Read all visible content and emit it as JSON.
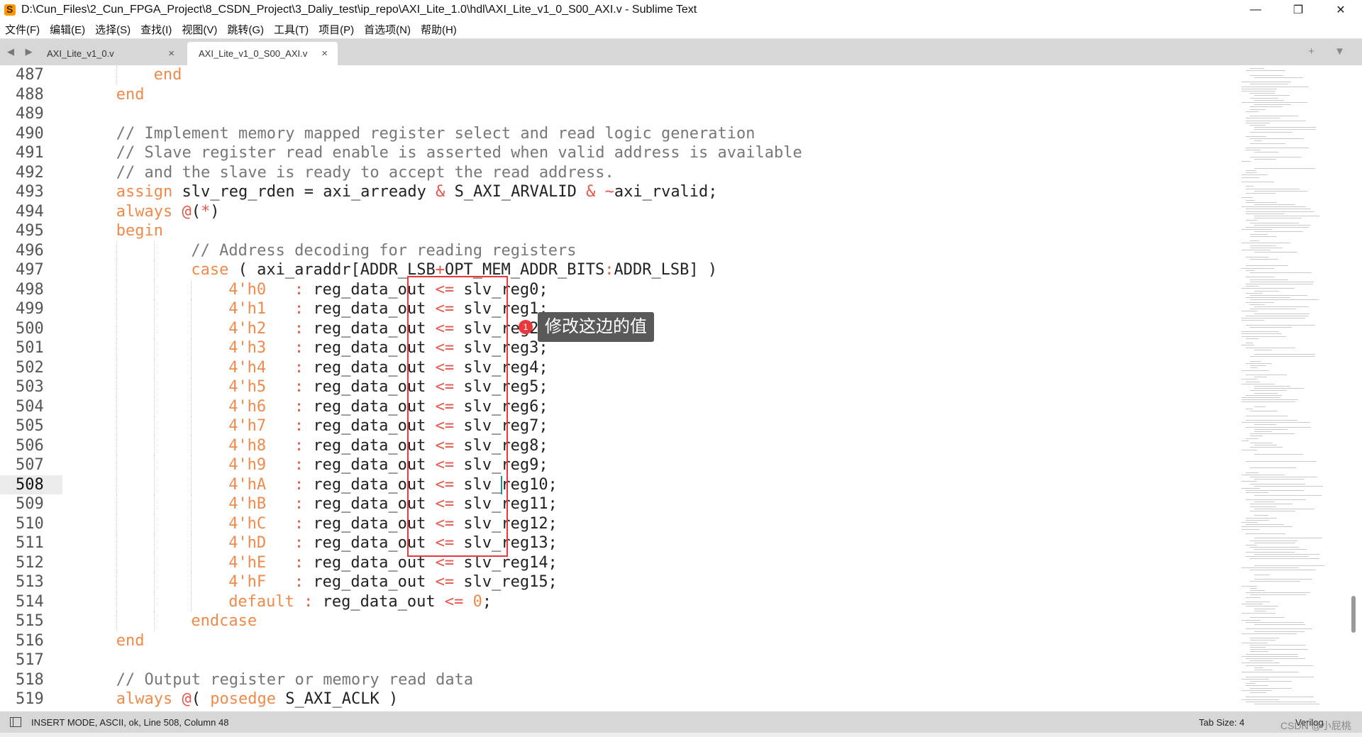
{
  "window": {
    "title": "D:\\Cun_Files\\2_Cun_FPGA_Project\\8_CSDN_Project\\3_Daliy_test\\ip_repo\\AXI_Lite_1.0\\hdl\\AXI_Lite_v1_0_S00_AXI.v - Sublime Text",
    "controls": [
      "—",
      "❐",
      "✕"
    ]
  },
  "menu": [
    "文件(F)",
    "编辑(E)",
    "选择(S)",
    "查找(I)",
    "视图(V)",
    "跳转(G)",
    "工具(T)",
    "项目(P)",
    "首选项(N)",
    "帮助(H)"
  ],
  "tabs": [
    {
      "label": "AXI_Lite_v1_0.v",
      "close": "×",
      "active": false
    },
    {
      "label": "AXI_Lite_v1_0_S00_AXI.v",
      "close": "×",
      "active": true
    }
  ],
  "tab_nav": "◀ ▶",
  "tab_right": "+ ▼",
  "editor": {
    "current_line": 508,
    "lines": [
      {
        "n": "487",
        "indent": 4,
        "tokens": [
          [
            "kw",
            "end"
          ]
        ]
      },
      {
        "n": "488",
        "indent": 2,
        "tokens": [
          [
            "kw",
            "end"
          ]
        ]
      },
      {
        "n": "489",
        "indent": 0,
        "tokens": []
      },
      {
        "n": "490",
        "indent": 2,
        "tokens": [
          [
            "cm",
            "// Implement memory mapped register select and read logic generation"
          ]
        ]
      },
      {
        "n": "491",
        "indent": 2,
        "tokens": [
          [
            "cm",
            "// Slave register read enable is asserted when valid address is available"
          ]
        ]
      },
      {
        "n": "492",
        "indent": 2,
        "tokens": [
          [
            "cm",
            "// and the slave is ready to accept the read address."
          ]
        ]
      },
      {
        "n": "493",
        "indent": 2,
        "tokens": [
          [
            "kw",
            "assign"
          ],
          [
            "tx",
            " slv_reg_rden = axi_arready "
          ],
          [
            "op",
            "&"
          ],
          [
            "tx",
            " S_AXI_ARVALID "
          ],
          [
            "op",
            "&"
          ],
          [
            "tx",
            " "
          ],
          [
            "op",
            "~"
          ],
          [
            "tx",
            "axi_rvalid;"
          ]
        ]
      },
      {
        "n": "494",
        "indent": 2,
        "tokens": [
          [
            "kw",
            "always"
          ],
          [
            "tx",
            " "
          ],
          [
            "op",
            "@"
          ],
          [
            "tx",
            "("
          ],
          [
            "op",
            "*"
          ],
          [
            "tx",
            ")"
          ]
        ]
      },
      {
        "n": "495",
        "indent": 2,
        "tokens": [
          [
            "kw",
            "begin"
          ]
        ]
      },
      {
        "n": "496",
        "indent": 6,
        "tokens": [
          [
            "cm",
            "// Address decoding for reading registers"
          ]
        ]
      },
      {
        "n": "497",
        "indent": 6,
        "tokens": [
          [
            "kw",
            "case"
          ],
          [
            "tx",
            " ( axi_araddr[ADDR_LSB"
          ],
          [
            "op",
            "+"
          ],
          [
            "tx",
            "OPT_MEM_ADDR_BITS"
          ],
          [
            "op",
            ":"
          ],
          [
            "tx",
            "ADDR_LSB] )"
          ]
        ]
      },
      {
        "n": "498",
        "indent": 8,
        "tokens": [
          [
            "nm",
            "4'h0"
          ],
          [
            "tx",
            "   "
          ],
          [
            "op",
            ":"
          ],
          [
            "tx",
            " reg_data_out "
          ],
          [
            "op",
            "<="
          ],
          [
            "tx",
            " slv_reg0;"
          ]
        ]
      },
      {
        "n": "499",
        "indent": 8,
        "tokens": [
          [
            "nm",
            "4'h1"
          ],
          [
            "tx",
            "   "
          ],
          [
            "op",
            ":"
          ],
          [
            "tx",
            " reg_data_out "
          ],
          [
            "op",
            "<="
          ],
          [
            "tx",
            " slv_reg1;"
          ]
        ]
      },
      {
        "n": "500",
        "indent": 8,
        "tokens": [
          [
            "nm",
            "4'h2"
          ],
          [
            "tx",
            "   "
          ],
          [
            "op",
            ":"
          ],
          [
            "tx",
            " reg_data_out "
          ],
          [
            "op",
            "<="
          ],
          [
            "tx",
            " slv_reg2;"
          ]
        ]
      },
      {
        "n": "501",
        "indent": 8,
        "tokens": [
          [
            "nm",
            "4'h3"
          ],
          [
            "tx",
            "   "
          ],
          [
            "op",
            ":"
          ],
          [
            "tx",
            " reg_data_out "
          ],
          [
            "op",
            "<="
          ],
          [
            "tx",
            " slv_reg3;"
          ]
        ]
      },
      {
        "n": "502",
        "indent": 8,
        "tokens": [
          [
            "nm",
            "4'h4"
          ],
          [
            "tx",
            "   "
          ],
          [
            "op",
            ":"
          ],
          [
            "tx",
            " reg_data_out "
          ],
          [
            "op",
            "<="
          ],
          [
            "tx",
            " slv_reg4;"
          ]
        ]
      },
      {
        "n": "503",
        "indent": 8,
        "tokens": [
          [
            "nm",
            "4'h5"
          ],
          [
            "tx",
            "   "
          ],
          [
            "op",
            ":"
          ],
          [
            "tx",
            " reg_data_out "
          ],
          [
            "op",
            "<="
          ],
          [
            "tx",
            " slv_reg5;"
          ]
        ]
      },
      {
        "n": "504",
        "indent": 8,
        "tokens": [
          [
            "nm",
            "4'h6"
          ],
          [
            "tx",
            "   "
          ],
          [
            "op",
            ":"
          ],
          [
            "tx",
            " reg_data_out "
          ],
          [
            "op",
            "<="
          ],
          [
            "tx",
            " slv_reg6;"
          ]
        ]
      },
      {
        "n": "505",
        "indent": 8,
        "tokens": [
          [
            "nm",
            "4'h7"
          ],
          [
            "tx",
            "   "
          ],
          [
            "op",
            ":"
          ],
          [
            "tx",
            " reg_data_out "
          ],
          [
            "op",
            "<="
          ],
          [
            "tx",
            " slv_reg7;"
          ]
        ]
      },
      {
        "n": "506",
        "indent": 8,
        "tokens": [
          [
            "nm",
            "4'h8"
          ],
          [
            "tx",
            "   "
          ],
          [
            "op",
            ":"
          ],
          [
            "tx",
            " reg_data_out "
          ],
          [
            "op",
            "<="
          ],
          [
            "tx",
            " slv_reg8;"
          ]
        ]
      },
      {
        "n": "507",
        "indent": 8,
        "tokens": [
          [
            "nm",
            "4'h9"
          ],
          [
            "tx",
            "   "
          ],
          [
            "op",
            ":"
          ],
          [
            "tx",
            " reg_data_out "
          ],
          [
            "op",
            "<="
          ],
          [
            "tx",
            " slv_reg9;"
          ]
        ]
      },
      {
        "n": "508",
        "indent": 8,
        "tokens": [
          [
            "nm",
            "4'hA"
          ],
          [
            "tx",
            "   "
          ],
          [
            "op",
            ":"
          ],
          [
            "tx",
            " reg_data_out "
          ],
          [
            "op",
            "<="
          ],
          [
            "tx",
            " slv_reg10;"
          ]
        ]
      },
      {
        "n": "509",
        "indent": 8,
        "tokens": [
          [
            "nm",
            "4'hB"
          ],
          [
            "tx",
            "   "
          ],
          [
            "op",
            ":"
          ],
          [
            "tx",
            " reg_data_out "
          ],
          [
            "op",
            "<="
          ],
          [
            "tx",
            " slv_reg11;"
          ]
        ]
      },
      {
        "n": "510",
        "indent": 8,
        "tokens": [
          [
            "nm",
            "4'hC"
          ],
          [
            "tx",
            "   "
          ],
          [
            "op",
            ":"
          ],
          [
            "tx",
            " reg_data_out "
          ],
          [
            "op",
            "<="
          ],
          [
            "tx",
            " slv_reg12;"
          ]
        ]
      },
      {
        "n": "511",
        "indent": 8,
        "tokens": [
          [
            "nm",
            "4'hD"
          ],
          [
            "tx",
            "   "
          ],
          [
            "op",
            ":"
          ],
          [
            "tx",
            " reg_data_out "
          ],
          [
            "op",
            "<="
          ],
          [
            "tx",
            " slv_reg13;"
          ]
        ]
      },
      {
        "n": "512",
        "indent": 8,
        "tokens": [
          [
            "nm",
            "4'hE"
          ],
          [
            "tx",
            "   "
          ],
          [
            "op",
            ":"
          ],
          [
            "tx",
            " reg_data_out "
          ],
          [
            "op",
            "<="
          ],
          [
            "tx",
            " slv_reg14;"
          ]
        ]
      },
      {
        "n": "513",
        "indent": 8,
        "tokens": [
          [
            "nm",
            "4'hF"
          ],
          [
            "tx",
            "   "
          ],
          [
            "op",
            ":"
          ],
          [
            "tx",
            " reg_data_out "
          ],
          [
            "op",
            "<="
          ],
          [
            "tx",
            " slv_reg15;"
          ]
        ]
      },
      {
        "n": "514",
        "indent": 8,
        "tokens": [
          [
            "kw",
            "default"
          ],
          [
            "tx",
            " "
          ],
          [
            "op",
            ":"
          ],
          [
            "tx",
            " reg_data_out "
          ],
          [
            "op",
            "<="
          ],
          [
            "tx",
            " "
          ],
          [
            "nm",
            "0"
          ],
          [
            "tx",
            ";"
          ]
        ]
      },
      {
        "n": "515",
        "indent": 6,
        "tokens": [
          [
            "kw",
            "endcase"
          ]
        ]
      },
      {
        "n": "516",
        "indent": 2,
        "tokens": [
          [
            "kw",
            "end"
          ]
        ]
      },
      {
        "n": "517",
        "indent": 0,
        "tokens": []
      },
      {
        "n": "518",
        "indent": 2,
        "tokens": [
          [
            "cm",
            "// Output register or memory read data"
          ]
        ]
      },
      {
        "n": "519",
        "indent": 2,
        "tokens": [
          [
            "kw",
            "always"
          ],
          [
            "tx",
            " "
          ],
          [
            "op",
            "@"
          ],
          [
            "tx",
            "( "
          ],
          [
            "kw",
            "posedge"
          ],
          [
            "tx",
            " S_AXI_ACLK )"
          ]
        ]
      }
    ]
  },
  "annotation": {
    "badge": "1",
    "text": "修改这边的值"
  },
  "status": {
    "left": "INSERT MODE, ASCII, ok, Line 508, Column 48",
    "tab_size": "Tab Size: 4",
    "syntax": "Verilog",
    "watermark": "CSDN @小屁桃"
  }
}
